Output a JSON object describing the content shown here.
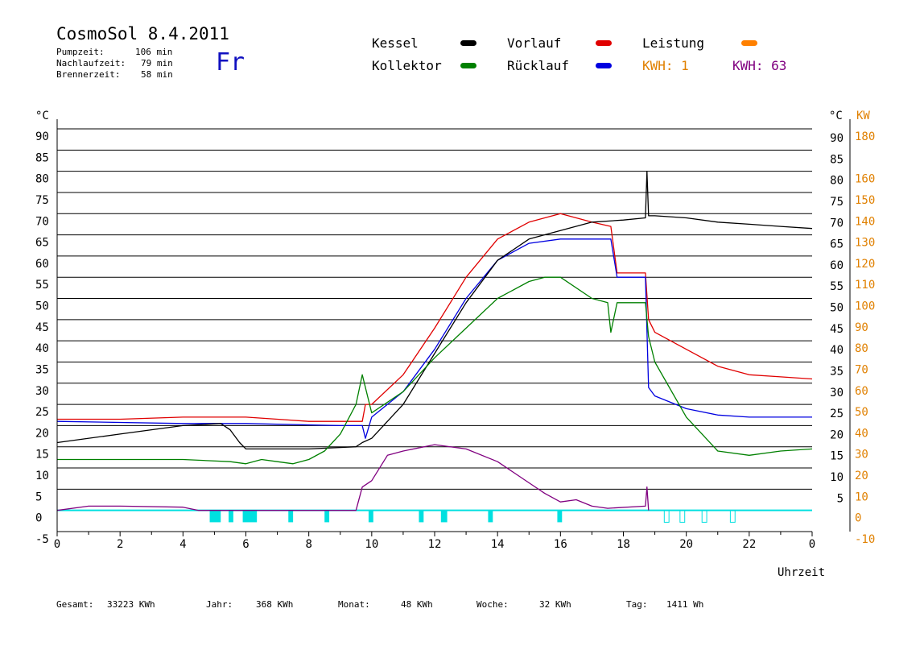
{
  "header": {
    "title": "CosmoSol 8.4.2011",
    "day": "Fr",
    "stats": [
      {
        "label": "Pumpzeit:",
        "value": "106 min"
      },
      {
        "label": "Nachlaufzeit:",
        "value": "79 min"
      },
      {
        "label": "Brennerzeit:",
        "value": "58 min"
      }
    ]
  },
  "legend": {
    "kessel": {
      "label": "Kessel",
      "color": "#000000"
    },
    "vorlauf": {
      "label": "Vorlauf",
      "color": "#e00000"
    },
    "leistung": {
      "label": "Leistung",
      "color": "#ff8000"
    },
    "kollektor": {
      "label": "Kollektor",
      "color": "#008000"
    },
    "ruecklauf": {
      "label": "Rücklauf",
      "color": "#0000e0"
    },
    "kwh1": {
      "label": "KWH:",
      "value": "1",
      "color": "#e08000"
    },
    "kwh2": {
      "label": "KWH:",
      "value": "63",
      "color": "#800080"
    }
  },
  "footer": {
    "gesamt": {
      "label": "Gesamt:",
      "value": "33223 KWh"
    },
    "jahr": {
      "label": "Jahr:",
      "value": "368 KWh"
    },
    "monat": {
      "label": "Monat:",
      "value": "48 KWh"
    },
    "woche": {
      "label": "Woche:",
      "value": "32 KWh"
    },
    "tag": {
      "label": "Tag:",
      "value": "1411 Wh"
    }
  },
  "chart_data": {
    "type": "line",
    "xlabel": "Uhrzeit",
    "ylabel_left": "°C",
    "ylabel_right_temp": "°C",
    "ylabel_right_power": "KW",
    "xlim": [
      0,
      24
    ],
    "ylim": [
      -5,
      90
    ],
    "x_ticks": [
      "0",
      "2",
      "4",
      "6",
      "8",
      "10",
      "12",
      "14",
      "16",
      "18",
      "20",
      "22",
      "0"
    ],
    "y_ticks_left": [
      90,
      85,
      80,
      75,
      70,
      65,
      60,
      55,
      50,
      45,
      40,
      35,
      30,
      25,
      20,
      15,
      10,
      5,
      0,
      -5
    ],
    "y_ticks_right_temp": [
      90,
      85,
      80,
      75,
      70,
      65,
      60,
      55,
      50,
      45,
      40,
      35,
      30,
      25,
      20,
      15,
      10,
      5
    ],
    "y_ticks_right_power": [
      180,
      160,
      150,
      140,
      130,
      120,
      110,
      100,
      90,
      80,
      70,
      60,
      50,
      40,
      30,
      20,
      10,
      0,
      -10
    ],
    "gridlines": "horizontal",
    "series": [
      {
        "name": "Vorlauf",
        "color": "#e00000",
        "x": [
          0,
          2,
          4,
          6,
          7,
          8,
          9,
          9.7,
          9.8,
          10,
          11,
          12,
          13,
          14,
          15,
          16,
          17,
          17.6,
          17.8,
          18,
          18.7,
          18.8,
          19,
          20,
          21,
          22,
          23,
          24
        ],
        "y": [
          21.5,
          21.5,
          22,
          22,
          21.5,
          21,
          21,
          21,
          25,
          25,
          32,
          43,
          55,
          64,
          68,
          70,
          68,
          67,
          56,
          56,
          56,
          45,
          42,
          38,
          34,
          32,
          31.5,
          31
        ]
      },
      {
        "name": "Rücklauf",
        "color": "#0000e0",
        "x": [
          0,
          4,
          6,
          9,
          9.7,
          9.8,
          10,
          11,
          12,
          13,
          14,
          15,
          16,
          17,
          17.6,
          17.8,
          18.7,
          18.8,
          19,
          20,
          21,
          22,
          23,
          24
        ],
        "y": [
          21,
          20.5,
          20.5,
          20,
          20,
          17,
          22,
          28,
          38,
          50,
          59,
          63,
          64,
          64,
          64,
          55,
          55,
          29,
          27,
          24,
          22.5,
          22,
          22,
          22
        ]
      },
      {
        "name": "Kessel",
        "color": "#000000",
        "x": [
          0,
          2,
          4,
          5.2,
          5.5,
          5.8,
          6,
          8,
          9.5,
          9.7,
          10,
          11,
          12,
          13,
          14,
          15,
          16,
          17,
          18,
          18.7,
          18.75,
          18.8,
          19,
          20,
          21,
          22,
          23,
          24
        ],
        "y": [
          16,
          18,
          20,
          20.5,
          19,
          16,
          14.5,
          14.5,
          15,
          16,
          17,
          25,
          37,
          49,
          59,
          64,
          66,
          68,
          68.5,
          69,
          80,
          69.5,
          69.5,
          69,
          68,
          67.5,
          67,
          66.5
        ]
      },
      {
        "name": "Kollektor",
        "color": "#008000",
        "x": [
          0,
          2,
          4,
          5.5,
          6,
          6.5,
          7,
          7.5,
          8,
          8.5,
          9,
          9.5,
          9.7,
          10,
          11,
          12,
          13,
          14,
          15,
          15.5,
          16,
          17,
          17.5,
          17.6,
          17.8,
          18.7,
          18.8,
          19,
          20,
          21,
          22,
          23,
          24
        ],
        "y": [
          12,
          12,
          12,
          11.5,
          11,
          12,
          11.5,
          11,
          12,
          14,
          18,
          25,
          32,
          23,
          28,
          36,
          43,
          50,
          54,
          55,
          55,
          50,
          49,
          42,
          49,
          49,
          41,
          35,
          22,
          14,
          13,
          14,
          14.5
        ]
      },
      {
        "name": "Leistung",
        "color": "#800080",
        "axis": "KW",
        "x": [
          0,
          1,
          2,
          4,
          4.5,
          9.5,
          9.7,
          10,
          10.5,
          11,
          12,
          13,
          14,
          15,
          15.5,
          16,
          16.5,
          17,
          17.5,
          18.7,
          18.75,
          18.8
        ],
        "y": [
          0,
          2,
          2,
          1.5,
          0,
          0,
          11,
          14,
          26,
          28,
          31,
          29,
          23,
          13,
          8,
          4,
          5,
          2,
          1,
          2,
          11,
          0
        ]
      }
    ],
    "burner_periods": [
      {
        "start": 4.85,
        "end": 5.2
      },
      {
        "start": 5.45,
        "end": 5.6
      },
      {
        "start": 5.9,
        "end": 6.35
      },
      {
        "start": 7.35,
        "end": 7.5
      },
      {
        "start": 8.5,
        "end": 8.65
      },
      {
        "start": 9.9,
        "end": 10.05
      },
      {
        "start": 11.5,
        "end": 11.65
      },
      {
        "start": 12.2,
        "end": 12.4
      },
      {
        "start": 13.7,
        "end": 13.85
      },
      {
        "start": 15.9,
        "end": 16.05
      }
    ],
    "pump_periods": [
      {
        "start": 19.3,
        "end": 19.45
      },
      {
        "start": 19.8,
        "end": 19.95
      },
      {
        "start": 20.5,
        "end": 20.65
      },
      {
        "start": 21.4,
        "end": 21.55
      }
    ]
  }
}
